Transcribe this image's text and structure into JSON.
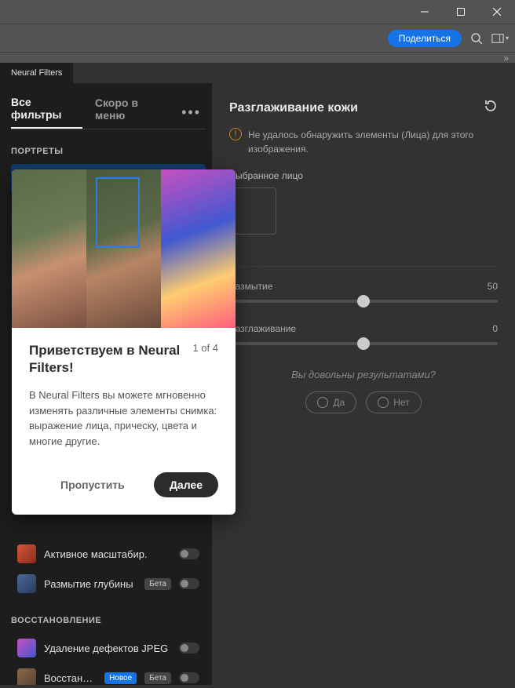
{
  "titlebar": {},
  "toolbar": {
    "share": "Поделиться"
  },
  "tab": "Neural Filters",
  "sidebar": {
    "tab_all": "Все фильтры",
    "tab_soon": "Скоро в меню",
    "cat_portraits": "ПОРТРЕТЫ",
    "items": {
      "smooth": "Разглаживание кожи",
      "zoom": "Активное масштабир.",
      "depth": "Размытие глубины",
      "depth_badge": "Бета"
    },
    "cat_restore": "ВОССТАНОВЛЕНИЕ",
    "jpeg": "Удаление дефектов JPEG",
    "restore": "Восстано...",
    "restore_new": "Новое",
    "restore_beta": "Бета"
  },
  "content": {
    "title": "Разглаживание кожи",
    "warn": "Не удалось обнаружить элементы (Лица) для этого изображения.",
    "face_label": "Выбранное лицо",
    "slider1": {
      "label": "Размытие",
      "value": "50"
    },
    "slider2": {
      "label": "Разглаживание",
      "value": "0"
    },
    "feedback_q": "Вы довольны результатами?",
    "yes": "Да",
    "no": "Нет"
  },
  "popover": {
    "title": "Приветствуем в Neural Filters!",
    "step": "1 of 4",
    "desc": "В Neural Filters вы можете мгновенно изменять различные элементы снимка: выражение лица, прическу, цвета и многие другие.",
    "skip": "Пропустить",
    "next": "Далее"
  }
}
